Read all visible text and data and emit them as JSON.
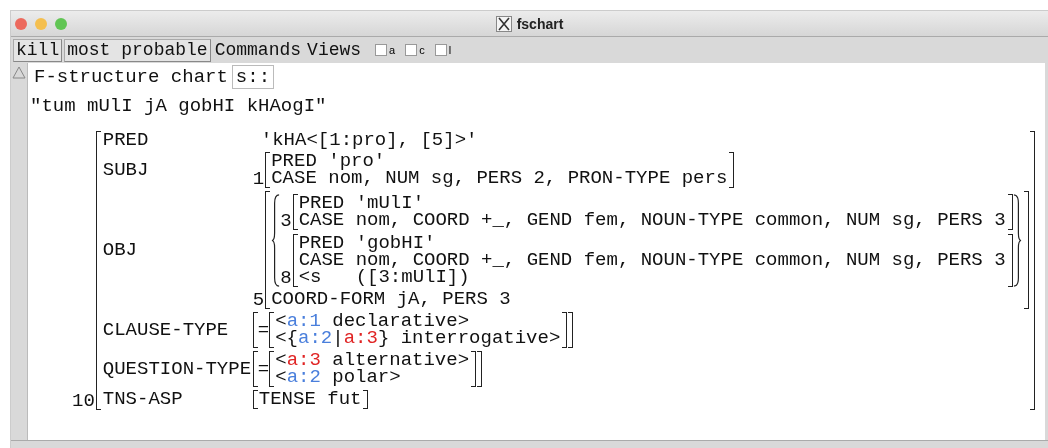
{
  "window": {
    "title": "fschart"
  },
  "toolbar": {
    "buttons": [
      "kill",
      "most probable"
    ],
    "menus": [
      "Commands",
      "Views"
    ],
    "checkboxes": [
      {
        "label": "a",
        "checked": false
      },
      {
        "label": "c",
        "checked": false
      },
      {
        "label": "l",
        "checked": false
      }
    ]
  },
  "chart_header": {
    "title": "F-structure chart",
    "field_value": "s::"
  },
  "sentence": "\"tum mUlI jA gobHI kHAogI\"",
  "fstructure": {
    "index": "10",
    "attributes": [
      {
        "name": "PRED",
        "value": {
          "kind": "text",
          "text": "'kHA<[1:pro], [5]>'"
        }
      },
      {
        "name": "SUBJ",
        "value": {
          "kind": "fs",
          "index": "1",
          "lines": [
            "PRED 'pro'",
            "CASE nom, NUM sg, PERS 2, PRON-TYPE pers"
          ]
        }
      },
      {
        "name": "OBJ",
        "value": {
          "kind": "set_fs",
          "index": "5",
          "members": [
            {
              "index": "3",
              "lines": [
                "PRED 'mUlI'",
                "CASE nom, COORD +_, GEND fem, NOUN-TYPE common, NUM sg, PERS 3"
              ]
            },
            {
              "index": "8",
              "lines": [
                "PRED 'gobHI'",
                "CASE nom, COORD +_, GEND fem, NOUN-TYPE common, NUM sg, PERS 3",
                "<s   ([3:mUlI])"
              ]
            }
          ],
          "lines": [
            "COORD-FORM jA, PERS 3"
          ]
        }
      },
      {
        "name": "CLAUSE-TYPE",
        "value": {
          "kind": "choice",
          "sign": "=",
          "options": [
            [
              {
                "text": "<"
              },
              {
                "text": "a:1",
                "color": "#4a7fdc"
              },
              {
                "text": " declarative>"
              }
            ],
            [
              {
                "text": "<{"
              },
              {
                "text": "a:2",
                "color": "#4a7fdc"
              },
              {
                "text": "|"
              },
              {
                "text": "a:3",
                "color": "#e02424"
              },
              {
                "text": "} interrogative>"
              }
            ]
          ]
        }
      },
      {
        "name": "QUESTION-TYPE",
        "value": {
          "kind": "choice",
          "sign": "=",
          "options": [
            [
              {
                "text": "<"
              },
              {
                "text": "a:3",
                "color": "#e02424"
              },
              {
                "text": " alternative>"
              }
            ],
            [
              {
                "text": "<"
              },
              {
                "text": "a:2",
                "color": "#4a7fdc"
              },
              {
                "text": " polar>"
              }
            ]
          ]
        }
      },
      {
        "name": "TNS-ASP",
        "value": {
          "kind": "fs",
          "lines": [
            "TENSE fut"
          ]
        }
      }
    ]
  }
}
